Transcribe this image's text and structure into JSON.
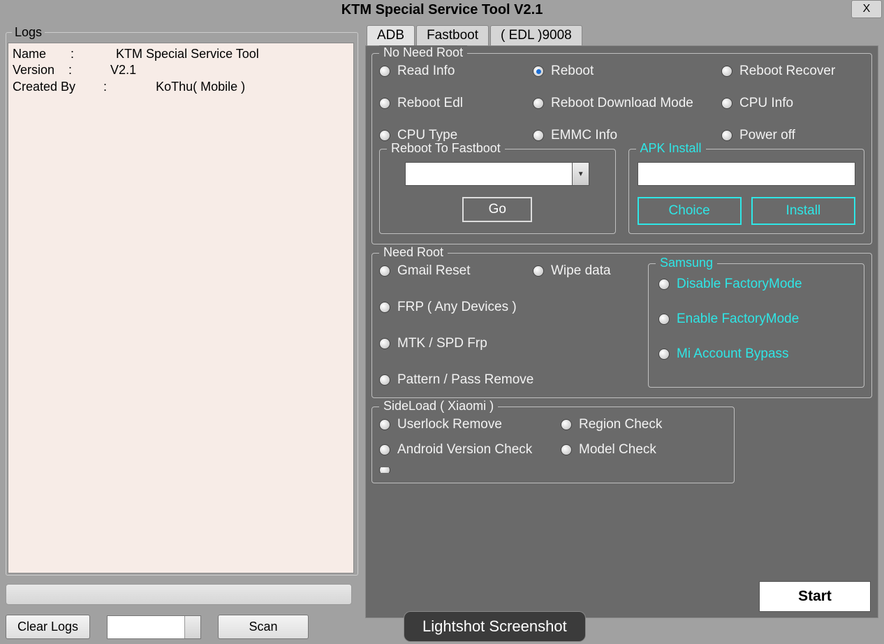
{
  "window": {
    "title": "KTM Special Service Tool V2.1",
    "close": "X"
  },
  "logs": {
    "legend": "Logs",
    "line1": "Name       :            KTM Special Service Tool",
    "line2": "Version    :           V2.1",
    "line3": "Created By        :              KoThu( Mobile )",
    "clear": "Clear Logs",
    "scan": "Scan"
  },
  "tabs": {
    "adb": "ADB",
    "fastboot": "Fastboot",
    "edl": "( EDL )9008"
  },
  "noNeedRoot": {
    "legend": "No Need Root",
    "readInfo": "Read Info",
    "reboot": "Reboot",
    "rebootRecover": "Reboot Recover",
    "rebootEdl": "Reboot Edl",
    "rebootDownload": "Reboot Download Mode",
    "cpuInfo": "CPU Info",
    "cpuType": "CPU Type",
    "emmcInfo": "EMMC Info",
    "powerOff": "Power off",
    "rebootToFastboot": "Reboot To Fastboot",
    "go": "Go",
    "apkInstall": "APK Install",
    "choice": "Choice",
    "install": "Install"
  },
  "needRoot": {
    "legend": "Need Root",
    "gmailReset": "Gmail Reset",
    "wipeData": "Wipe data",
    "frp": "FRP ( Any Devices )",
    "mtkSpd": "MTK / SPD Frp",
    "pattern": "Pattern / Pass Remove",
    "samsung": "Samsung",
    "disableFactory": "Disable FactoryMode",
    "enableFactory": "Enable FactoryMode",
    "miBypass": "Mi Account Bypass"
  },
  "sideload": {
    "legend": "SideLoad ( Xiaomi )",
    "userlock": "Userlock Remove",
    "regionCheck": "Region Check",
    "androidVersion": "Android Version Check",
    "modelCheck": "Model Check"
  },
  "start": "Start",
  "badge": "Lightshot Screenshot"
}
